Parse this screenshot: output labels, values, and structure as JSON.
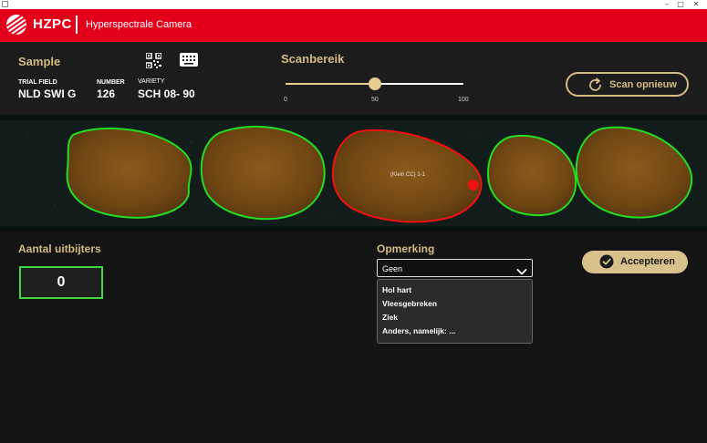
{
  "window": {
    "controls": [
      "–",
      "□",
      "✕"
    ]
  },
  "header": {
    "brand": "HZPC",
    "app_title": "Hyperspectrale Camera"
  },
  "sample": {
    "title": "Sample",
    "trial_field_label": "TRIAL FIELD",
    "trial_field_value": "NLD SWI G",
    "number_label": "NUMBER",
    "number_value": "126",
    "variety_label": "VARIETY",
    "variety_value": "SCH 08- 90"
  },
  "scan_range": {
    "title": "Scanbereik",
    "value": 50,
    "min_label": "0",
    "mid_label": "50",
    "max_label": "100",
    "rescan_label": "Scan opnieuw"
  },
  "scan_image": {
    "selected_label": "(Klein CC) 1-1",
    "outline_ok_color": "#22dd22",
    "outline_selected_color": "#ee1111"
  },
  "outliers": {
    "title": "Aantal uitbijters",
    "value": "0"
  },
  "remark": {
    "title": "Opmerking",
    "selected": "Geen",
    "options": [
      "Hol hart",
      "Vleesgebreken",
      "Ziek",
      "Anders, namelijk: ..."
    ]
  },
  "accept": {
    "label": "Accepteren"
  },
  "colors": {
    "brand_red": "#e3001b",
    "accent_gold": "#d4bb82",
    "outlier_green": "#3fd63f"
  }
}
